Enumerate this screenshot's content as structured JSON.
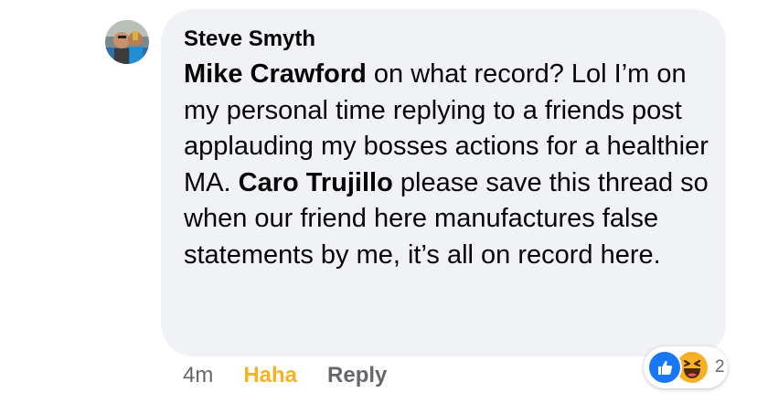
{
  "comment": {
    "author": "Steve Smyth",
    "body": [
      {
        "text": "Mike Crawford",
        "mention": true
      },
      {
        "text": " on what record? Lol I’m on my personal time replying to a friends post applauding my bosses actions for a healthier MA. ",
        "mention": false
      },
      {
        "text": "Caro Trujillo",
        "mention": true
      },
      {
        "text": " please save this thread so when our friend here manufactures false statements by me, it’s all on record here.",
        "mention": false
      }
    ]
  },
  "actions": {
    "time": "4m",
    "reaction_label": "Haha",
    "reply_label": "Reply"
  },
  "reactions": {
    "icons": [
      "like-icon",
      "haha-icon"
    ],
    "count": "2"
  },
  "colors": {
    "bubble": "#f0f2f5",
    "haha": "#f7b125",
    "like": "#1877f2",
    "secondary_text": "#65676b"
  }
}
